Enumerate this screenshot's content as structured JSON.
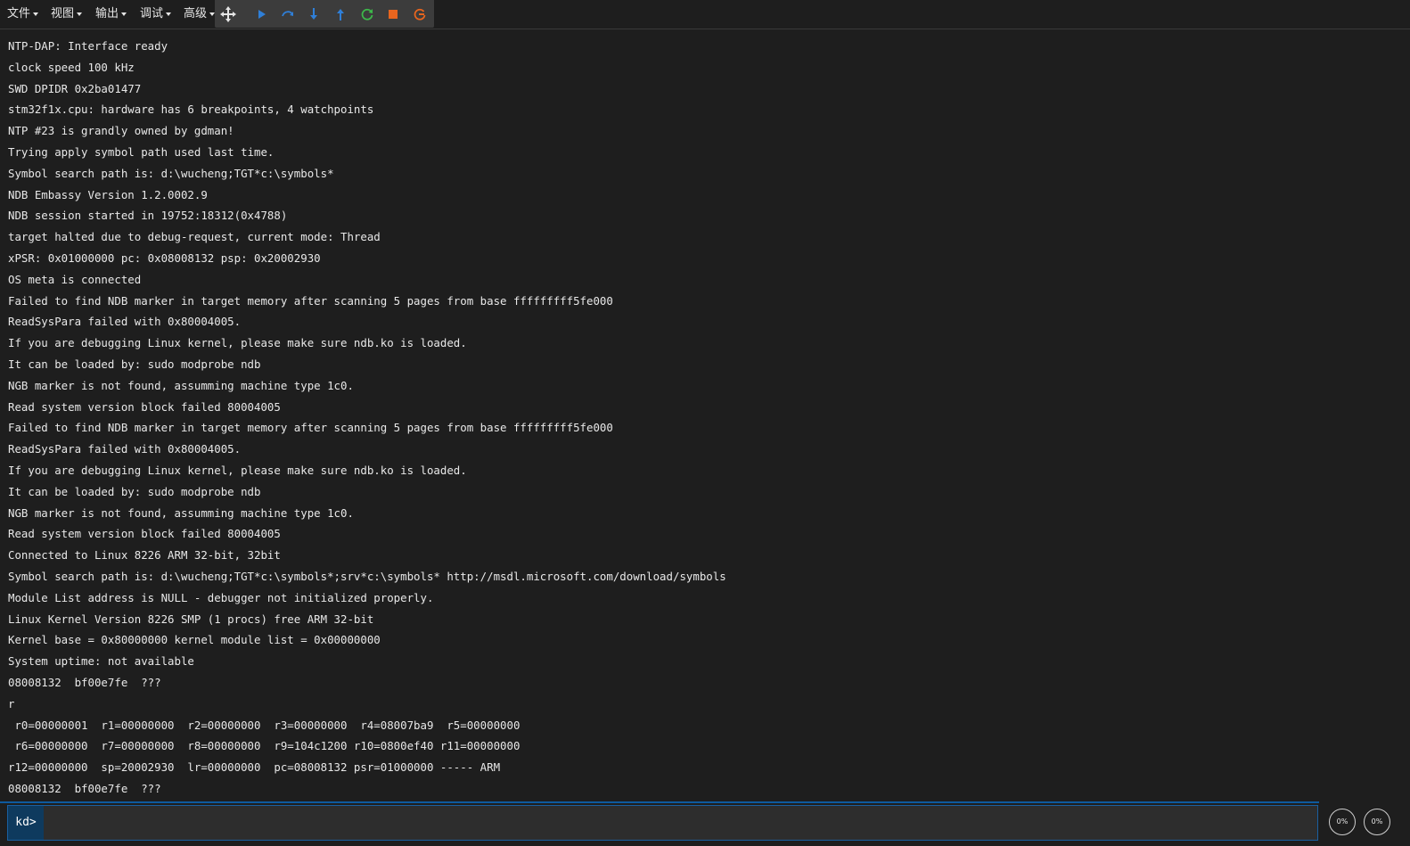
{
  "menu": {
    "file": "文件",
    "view": "视图",
    "output": "输出",
    "debug": "调试",
    "advanced": "高级"
  },
  "toolbar": {
    "icons": [
      "move-icon",
      "run-icon",
      "step-over-icon",
      "step-into-icon",
      "step-out-icon",
      "restart-icon",
      "stop-icon",
      "detach-icon"
    ],
    "colors": {
      "run": "#2f7fd8",
      "step": "#2f7fd8",
      "restart": "#3db84a",
      "stop": "#e8651e",
      "detach": "#e8651e"
    }
  },
  "console": {
    "lines": [
      "NTP-DAP: Interface ready",
      "clock speed 100 kHz",
      "SWD DPIDR 0x2ba01477",
      "stm32f1x.cpu: hardware has 6 breakpoints, 4 watchpoints",
      "NTP #23 is grandly owned by gdman!",
      "Trying apply symbol path used last time.",
      "Symbol search path is: d:\\wucheng;TGT*c:\\symbols*",
      "NDB Embassy Version 1.2.0002.9",
      "NDB session started in 19752:18312(0x4788)",
      "target halted due to debug-request, current mode: Thread",
      "xPSR: 0x01000000 pc: 0x08008132 psp: 0x20002930",
      "OS meta is connected",
      "Failed to find NDB marker in target memory after scanning 5 pages from base fffffffff5fe000",
      "ReadSysPara failed with 0x80004005.",
      "If you are debugging Linux kernel, please make sure ndb.ko is loaded.",
      "It can be loaded by: sudo modprobe ndb",
      "NGB marker is not found, assumming machine type 1c0.",
      "Read system version block failed 80004005",
      "Failed to find NDB marker in target memory after scanning 5 pages from base fffffffff5fe000",
      "ReadSysPara failed with 0x80004005.",
      "If you are debugging Linux kernel, please make sure ndb.ko is loaded.",
      "It can be loaded by: sudo modprobe ndb",
      "NGB marker is not found, assumming machine type 1c0.",
      "Read system version block failed 80004005",
      "Connected to Linux 8226 ARM 32-bit, 32bit",
      "Symbol search path is: d:\\wucheng;TGT*c:\\symbols*;srv*c:\\symbols* http://msdl.microsoft.com/download/symbols",
      "Module List address is NULL - debugger not initialized properly.",
      "Linux Kernel Version 8226 SMP (1 procs) free ARM 32-bit",
      "Kernel base = 0x80000000 kernel module list = 0x00000000",
      "System uptime: not available",
      "08008132  bf00e7fe  ???",
      "r",
      " r0=00000001  r1=00000000  r2=00000000  r3=00000000  r4=08007ba9  r5=00000000",
      " r6=00000000  r7=00000000  r8=00000000  r9=104c1200 r10=0800ef40 r11=00000000",
      "r12=00000000  sp=20002930  lr=00000000  pc=08008132 psr=01000000 ----- ARM",
      "08008132  bf00e7fe  ???"
    ]
  },
  "command": {
    "prompt": "kd>",
    "value": ""
  },
  "gauges": {
    "left": {
      "label": "0%",
      "percent": 0
    },
    "right": {
      "label": "0%",
      "percent": 0
    }
  }
}
